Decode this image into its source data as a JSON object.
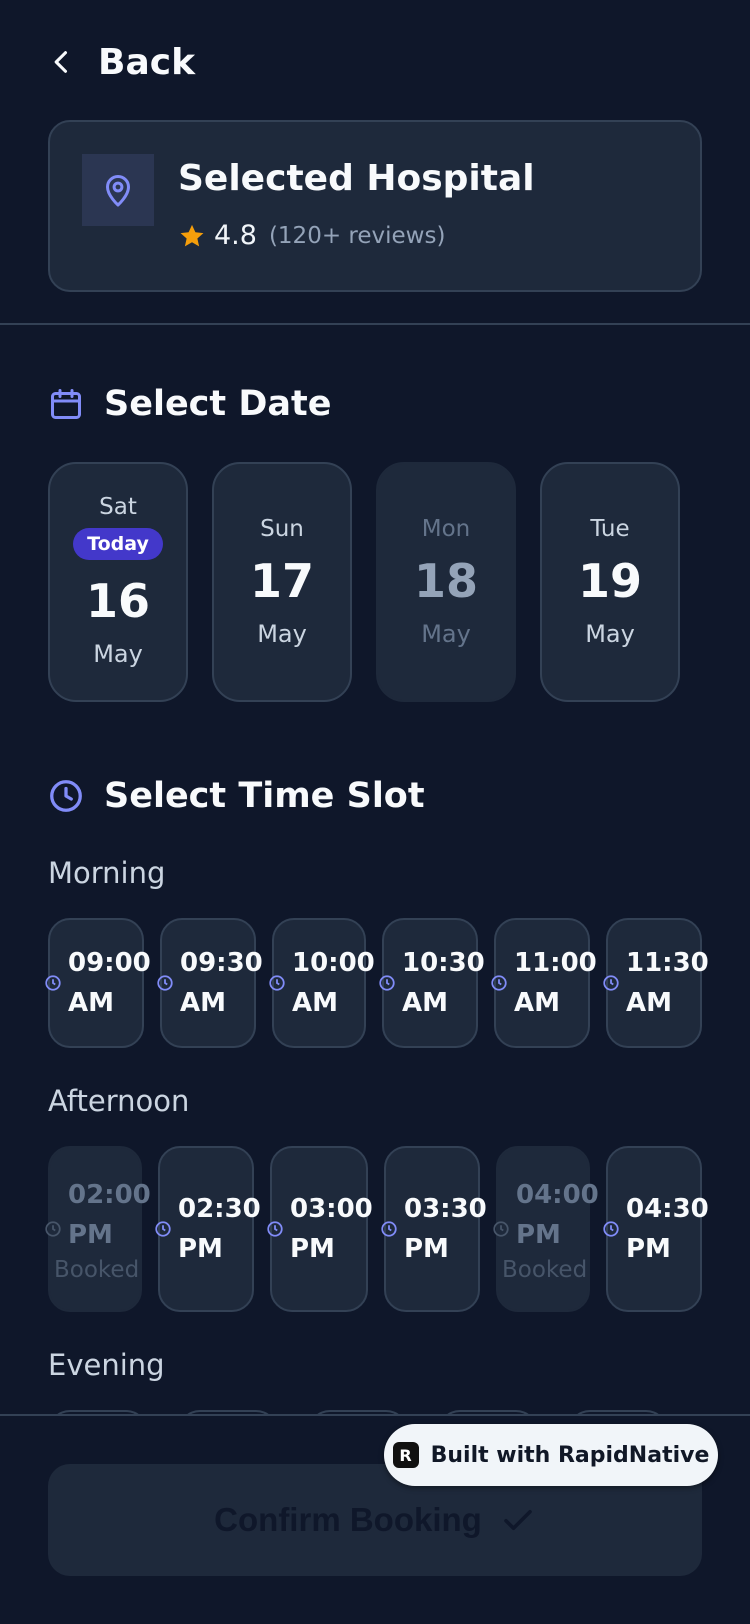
{
  "header": {
    "back_label": "Back"
  },
  "hospital": {
    "name": "Selected Hospital",
    "rating": "4.8",
    "reviews": "(120+ reviews)"
  },
  "date_section": {
    "title": "Select Date",
    "today_badge": "Today",
    "dates": [
      {
        "weekday": "Sat",
        "day": "16",
        "month": "May",
        "today": true,
        "disabled": false
      },
      {
        "weekday": "Sun",
        "day": "17",
        "month": "May",
        "today": false,
        "disabled": false
      },
      {
        "weekday": "Mon",
        "day": "18",
        "month": "May",
        "today": false,
        "disabled": true
      },
      {
        "weekday": "Tue",
        "day": "19",
        "month": "May",
        "today": false,
        "disabled": false
      }
    ]
  },
  "time_section": {
    "title": "Select Time Slot",
    "morning_label": "Morning",
    "afternoon_label": "Afternoon",
    "evening_label": "Evening",
    "booked_label": "Booked",
    "morning": [
      {
        "time": "09:00\nAM",
        "booked": false
      },
      {
        "time": "09:30\nAM",
        "booked": false
      },
      {
        "time": "10:00\nAM",
        "booked": false
      },
      {
        "time": "10:30\nAM",
        "booked": false
      },
      {
        "time": "11:00\nAM",
        "booked": false
      },
      {
        "time": "11:30\nAM",
        "booked": false
      }
    ],
    "afternoon": [
      {
        "time": "02:00\nPM",
        "booked": true
      },
      {
        "time": "02:30\nPM",
        "booked": false
      },
      {
        "time": "03:00\nPM",
        "booked": false
      },
      {
        "time": "03:30\nPM",
        "booked": false
      },
      {
        "time": "04:00\nPM",
        "booked": true
      },
      {
        "time": "04:30\nPM",
        "booked": false
      }
    ]
  },
  "confirm": {
    "label": "Confirm Booking"
  },
  "badge": {
    "label": "Built with RapidNative"
  },
  "colors": {
    "background": "#0f172a",
    "card": "#1e293b",
    "border": "#334155",
    "accent": "#818cf8",
    "today_badge": "#4338ca",
    "star": "#f59e0b"
  }
}
